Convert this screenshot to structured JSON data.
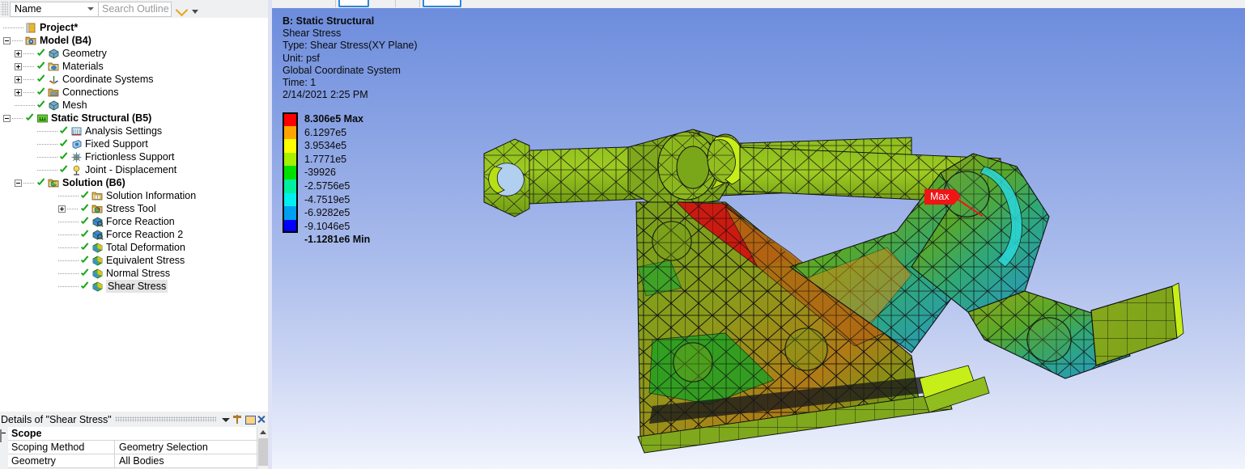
{
  "outline_toolbar": {
    "filter_label": "Name",
    "search_placeholder": "Search Outline",
    "search_value": "",
    "expand_icon": "chevron-down-icon",
    "more_icon": "caret-down-icon"
  },
  "tree": {
    "items": [
      {
        "label": "Project*",
        "depth": 0,
        "bold": true,
        "expander": "none",
        "check": false,
        "icon": "project-icon",
        "selected": false
      },
      {
        "label": "Model (B4)",
        "depth": 1,
        "bold": true,
        "expander": "minus",
        "check": false,
        "icon": "model-icon",
        "selected": false
      },
      {
        "label": "Geometry",
        "depth": 2,
        "bold": false,
        "expander": "plus",
        "check": true,
        "icon": "geometry-icon",
        "selected": false
      },
      {
        "label": "Materials",
        "depth": 2,
        "bold": false,
        "expander": "plus",
        "check": true,
        "icon": "materials-icon",
        "selected": false
      },
      {
        "label": "Coordinate Systems",
        "depth": 2,
        "bold": false,
        "expander": "plus",
        "check": true,
        "icon": "coordinate-systems-icon",
        "selected": false
      },
      {
        "label": "Connections",
        "depth": 2,
        "bold": false,
        "expander": "plus",
        "check": true,
        "icon": "connections-icon",
        "selected": false
      },
      {
        "label": "Mesh",
        "depth": 2,
        "bold": false,
        "expander": "none",
        "check": true,
        "icon": "mesh-icon",
        "selected": false
      },
      {
        "label": "Static Structural (B5)",
        "depth": 1,
        "bold": true,
        "expander": "minus",
        "check": true,
        "icon": "static-structural-icon",
        "selected": false
      },
      {
        "label": "Analysis Settings",
        "depth": 3,
        "bold": false,
        "expander": "none",
        "check": true,
        "icon": "analysis-settings-icon",
        "selected": false
      },
      {
        "label": "Fixed Support",
        "depth": 3,
        "bold": false,
        "expander": "none",
        "check": true,
        "icon": "fixed-support-icon",
        "selected": false
      },
      {
        "label": "Frictionless Support",
        "depth": 3,
        "bold": false,
        "expander": "none",
        "check": true,
        "icon": "frictionless-support-icon",
        "selected": false
      },
      {
        "label": "Joint - Displacement",
        "depth": 3,
        "bold": false,
        "expander": "none",
        "check": true,
        "icon": "joint-displacement-icon",
        "selected": false
      },
      {
        "label": "Solution (B6)",
        "depth": 2,
        "bold": true,
        "expander": "minus",
        "check": true,
        "icon": "solution-icon",
        "selected": false
      },
      {
        "label": "Solution Information",
        "depth": 4,
        "bold": false,
        "expander": "none",
        "check": true,
        "icon": "solution-information-icon",
        "selected": false
      },
      {
        "label": "Stress Tool",
        "depth": 4,
        "bold": false,
        "expander": "plus",
        "check": true,
        "icon": "stress-tool-icon",
        "selected": false
      },
      {
        "label": "Force Reaction",
        "depth": 4,
        "bold": false,
        "expander": "none",
        "check": true,
        "icon": "force-reaction-icon",
        "selected": false
      },
      {
        "label": "Force Reaction 2",
        "depth": 4,
        "bold": false,
        "expander": "none",
        "check": true,
        "icon": "force-reaction-icon",
        "selected": false
      },
      {
        "label": "Total Deformation",
        "depth": 4,
        "bold": false,
        "expander": "none",
        "check": true,
        "icon": "result-icon",
        "selected": false
      },
      {
        "label": "Equivalent Stress",
        "depth": 4,
        "bold": false,
        "expander": "none",
        "check": true,
        "icon": "result-icon",
        "selected": false
      },
      {
        "label": "Normal Stress",
        "depth": 4,
        "bold": false,
        "expander": "none",
        "check": true,
        "icon": "result-icon",
        "selected": false
      },
      {
        "label": "Shear Stress",
        "depth": 4,
        "bold": false,
        "expander": "none",
        "check": true,
        "icon": "result-icon",
        "selected": true
      }
    ]
  },
  "details": {
    "title": "Details of \"Shear Stress\"",
    "dropdown_icon": "caret-down-icon",
    "pin_icon": "pin-icon",
    "maximize_icon": "maximize-icon",
    "close_icon": "close-icon",
    "rows": [
      {
        "kind": "header",
        "label": "Scope"
      },
      {
        "kind": "pair",
        "key": "Scoping Method",
        "value": "Geometry Selection"
      },
      {
        "kind": "pair",
        "key": "Geometry",
        "value": "All Bodies"
      }
    ]
  },
  "viewport": {
    "header": {
      "title": "B: Static Structural",
      "lines": [
        "Shear Stress",
        "Type: Shear Stress(XY Plane)",
        "Unit: psf",
        "Global Coordinate System",
        "Time: 1",
        "2/14/2021 2:25 PM"
      ]
    },
    "max_annotation": {
      "label": "Max",
      "color": "#f01414"
    },
    "background": {
      "top_color": "#6b8bdc",
      "bottom_color": "#f2f5fd"
    }
  },
  "chart_data": {
    "type": "heatmap",
    "title": "Shear Stress",
    "subtitle": "Type: Shear Stress(XY Plane)",
    "unit": "psf",
    "coordinate_system": "Global Coordinate System",
    "time": "1",
    "timestamp": "2/14/2021 2:25 PM",
    "legend_position": "left",
    "max_value": "8.306e5",
    "min_value": "-1.1281e6",
    "bands": [
      {
        "label": "8.306e5 Max",
        "color": "#ff0000",
        "bold": true
      },
      {
        "label": "6.1297e5",
        "color": "#ffa500",
        "bold": false
      },
      {
        "label": "3.9534e5",
        "color": "#ffff00",
        "bold": false
      },
      {
        "label": "1.7771e5",
        "color": "#a6f000",
        "bold": false
      },
      {
        "label": "-39926",
        "color": "#00e000",
        "bold": false
      },
      {
        "label": "-2.5756e5",
        "color": "#00f0a0",
        "bold": false
      },
      {
        "label": "-4.7519e5",
        "color": "#00f0f0",
        "bold": false
      },
      {
        "label": "-6.9282e5",
        "color": "#00a0f0",
        "bold": false
      },
      {
        "label": "-9.1046e5",
        "color": "#0000ff",
        "bold": false
      },
      {
        "label": "-1.1281e6 Min",
        "color": null,
        "bold": true
      }
    ]
  }
}
